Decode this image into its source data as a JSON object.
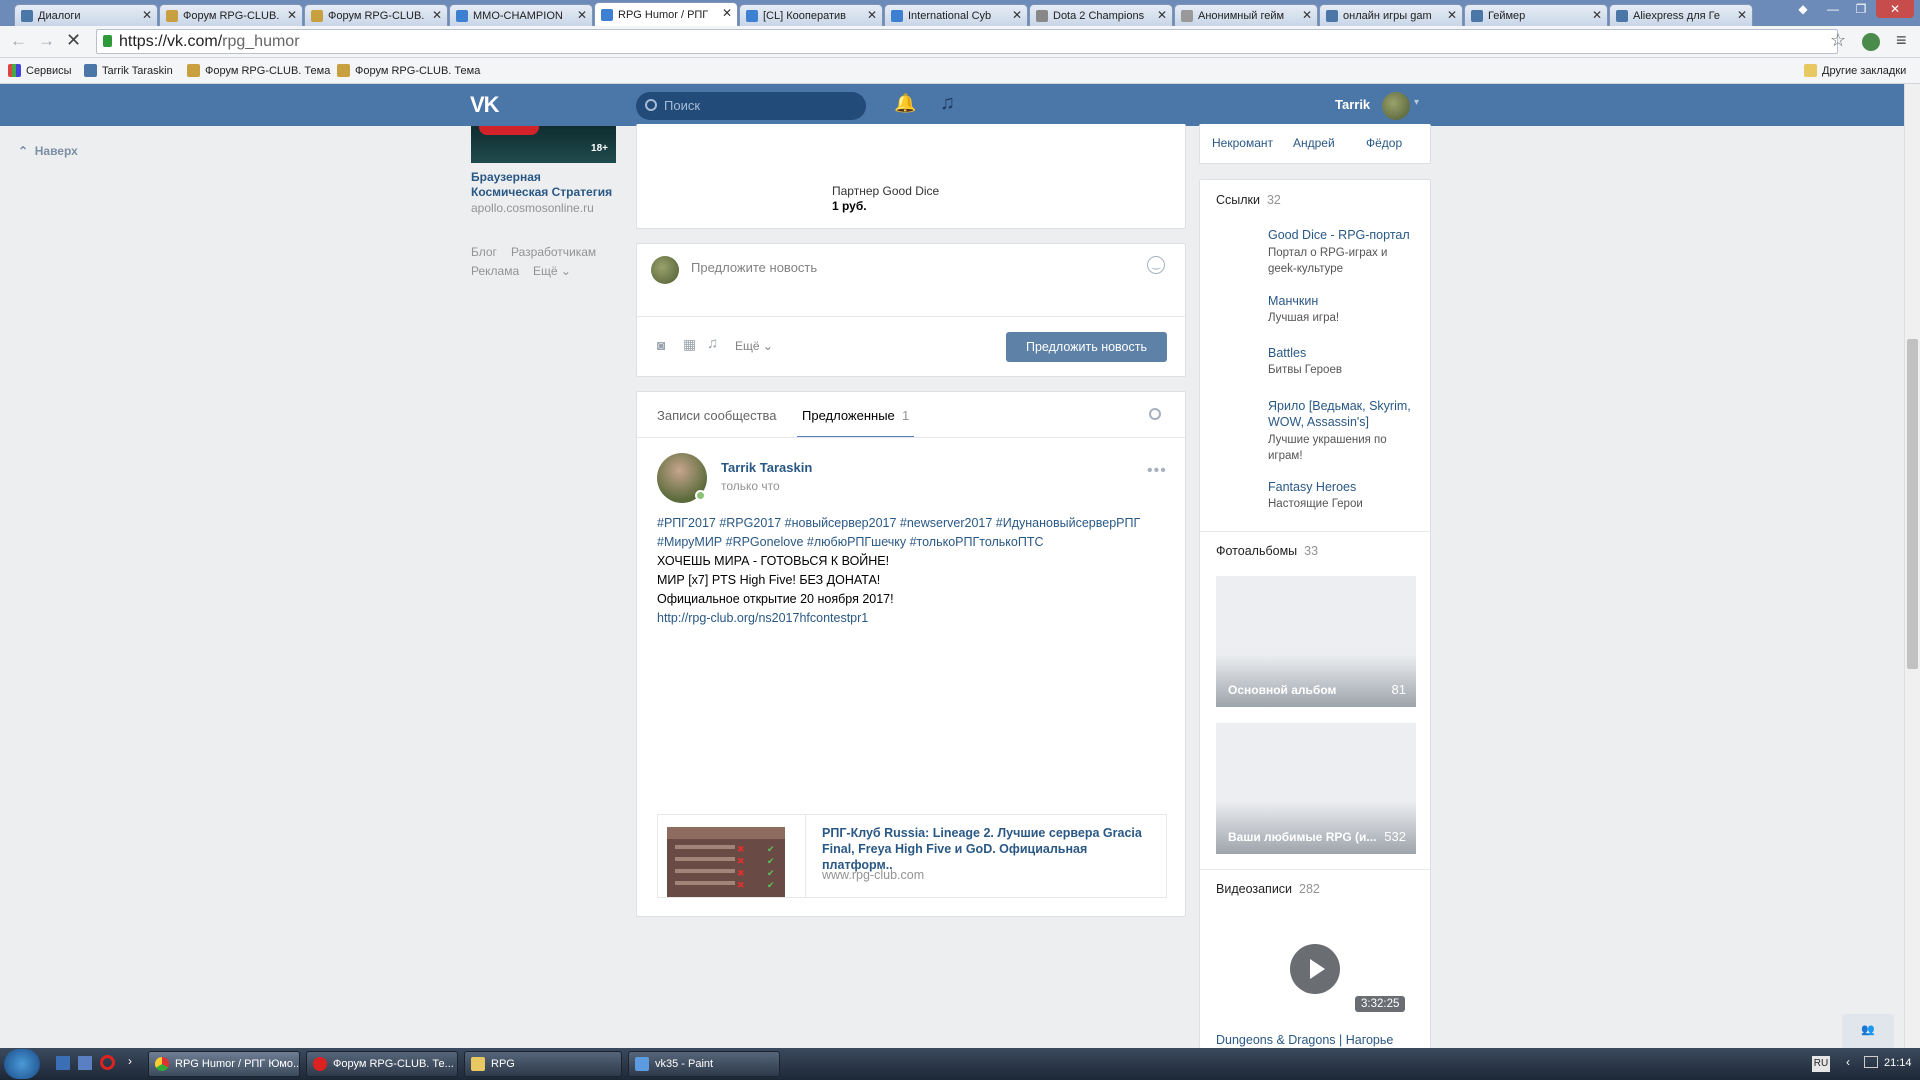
{
  "browser": {
    "tabs": [
      {
        "label": "Диалоги",
        "color": "#4a76a8"
      },
      {
        "label": "Форум RPG-CLUB.",
        "color": "#c8a040"
      },
      {
        "label": "Форум RPG-CLUB.",
        "color": "#c8a040"
      },
      {
        "label": "MMO-CHAMPION",
        "color": "#3d7fd1"
      },
      {
        "label": "RPG Humor / РПГ",
        "color": "#3d7fd1",
        "active": true
      },
      {
        "label": "[CL] Кооператив",
        "color": "#3d7fd1"
      },
      {
        "label": "International Cyb",
        "color": "#3d7fd1"
      },
      {
        "label": "Dota 2 Champions",
        "color": "#888888"
      },
      {
        "label": "Анонимный гейм",
        "color": "#999999"
      },
      {
        "label": "онлайн игры gam",
        "color": "#4a76a8"
      },
      {
        "label": "Геймер",
        "color": "#4a76a8"
      },
      {
        "label": "Aliexpress для Ге",
        "color": "#4a76a8"
      }
    ],
    "url_host": "https://vk.com/",
    "url_path": "rpg_humor",
    "bookmarks": [
      "Сервисы",
      "Tarrik Taraskin",
      "Форум RPG-CLUB. Тема",
      "Форум RPG-CLUB. Тема"
    ],
    "other_bookmarks": "Другие закладки"
  },
  "vk": {
    "search_placeholder": "Поиск",
    "user_name": "Tarrik",
    "to_top": "Наверх",
    "ad": {
      "badge": "18+",
      "title": "Браузерная Космическая Стратегия",
      "domain": "apollo.cosmosonline.ru"
    },
    "footer_links": [
      "Блог",
      "Разработчикам",
      "Реклама",
      "Ещё"
    ],
    "product": {
      "name": "Партнер Good Dice",
      "price": "1 руб."
    },
    "suggest_placeholder": "Предложите новость",
    "more_label": "Ещё",
    "suggest_button": "Предложить новость",
    "tabs": {
      "wall": "Записи сообщества",
      "suggested": "Предложенные",
      "suggested_count": "1"
    },
    "post": {
      "author": "Tarrik Taraskin",
      "time": "только что",
      "hashtags_1": "#РПГ2017 #RPG2017 #новыйсервер2017 #newserver2017 #ИдунановыйсерверРПГ",
      "hashtags_2": "#МируМИР #RPGonelove #любюРПГшечку #толькоРПГтолькоПТС",
      "line_1": "ХОЧЕШЬ МИРА - ГОТОВЬСЯ К ВОЙНЕ!",
      "line_2": "МИР [x7] PTS High Five! БЕЗ ДОНАТА!",
      "line_3": "Официальное открытие 20 ноября 2017!",
      "link": "http://rpg-club.org/ns2017hfcontestpr1",
      "snippet_title": "РПГ-Клуб Russia: Lineage 2. Лучшие сервера Gracia Final, Freya High Five и GoD. Официальная платформ..",
      "snippet_domain": "www.rpg-club.com"
    },
    "members": [
      "Некромант",
      "Андрей",
      "Фёдор"
    ],
    "links_block": {
      "title": "Ссылки",
      "count": "32",
      "items": [
        {
          "title": "Good Dice - RPG-портал",
          "desc": "Портал о RPG-играх и geek-культуре"
        },
        {
          "title": "Манчкин",
          "desc": "Лучшая игра!"
        },
        {
          "title": "Battles",
          "desc": "Битвы Героев"
        },
        {
          "title": "Ярило [Ведьмак, Skyrim, WOW, Assassin's]",
          "desc": "Лучшие украшения по играм!"
        },
        {
          "title": "Fantasy Heroes",
          "desc": "Настоящие Герои"
        }
      ]
    },
    "albums": {
      "title": "Фотоальбомы",
      "count": "33",
      "items": [
        {
          "name": "Основной альбом",
          "count": "81"
        },
        {
          "name": "Ваши любимые RPG (и...",
          "count": "532"
        }
      ]
    },
    "videos": {
      "title": "Видеозаписи",
      "count": "282",
      "duration": "3:32:25",
      "video_title": "Dungeons & Dragons | Нагорье"
    }
  },
  "taskbar": {
    "tasks": [
      "RPG Humor / РПГ Юмо...",
      "Форум RPG-CLUB. Те...",
      "RPG",
      "vk35 - Paint"
    ],
    "lang": "RU",
    "time": "21:14"
  }
}
